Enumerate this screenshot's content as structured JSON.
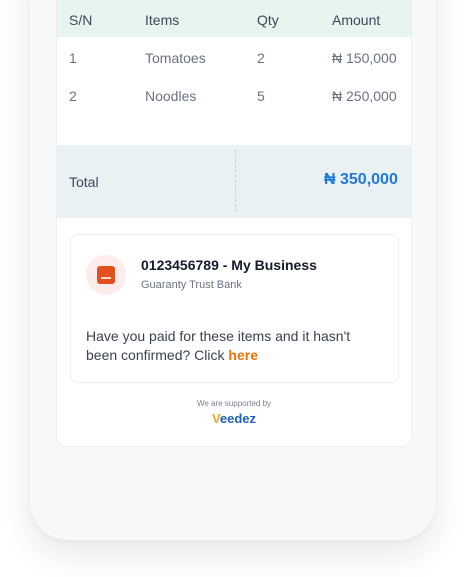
{
  "table": {
    "headers": {
      "sn": "S/N",
      "items": "Items",
      "qty": "Qty",
      "amount": "Amount"
    },
    "rows": [
      {
        "sn": "1",
        "item": "Tomatoes",
        "qty": "2",
        "amount": "₦ 150,000"
      },
      {
        "sn": "2",
        "item": "Noodles",
        "qty": "5",
        "amount": "₦ 250,000"
      }
    ],
    "total_label": "Total",
    "total_value": "₦ 350,000"
  },
  "bank": {
    "account": "0123456789 - My Business",
    "bank_name": "Guaranty Trust Bank",
    "logo_icon": "gtbank-logo-icon",
    "logo_color": "#e3501e"
  },
  "help": {
    "text": "Have you paid for these items and it hasn't been confirmed? Click ",
    "link": "here"
  },
  "footer": {
    "supported_by": "We are supported by",
    "brand_first": "V",
    "brand_rest": "eedez"
  },
  "colors": {
    "accent": "#1f7ae0",
    "link": "#e8730c",
    "header_bg": "#e8f4ee",
    "total_bg": "#e9f1f3"
  }
}
